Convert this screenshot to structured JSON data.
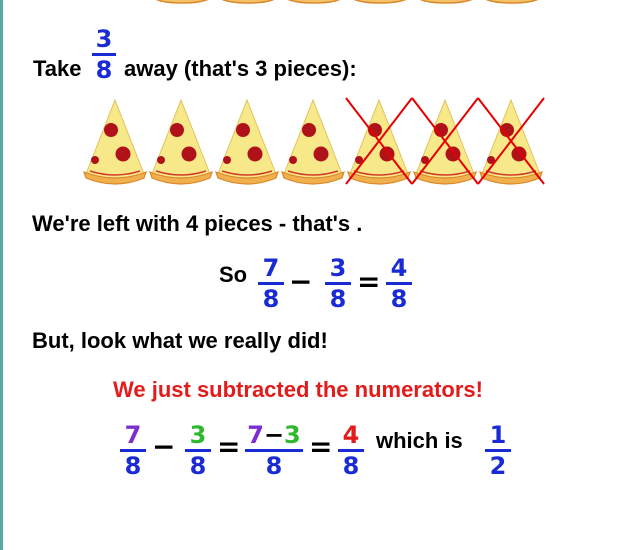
{
  "take_line": {
    "before": "Take",
    "fraction": {
      "num": "3",
      "den": "8"
    },
    "after": "away (that's 3 pieces):"
  },
  "pizza_row": {
    "total": 7,
    "crossed_out": 3
  },
  "left_line": "We're left with 4 pieces - that's .",
  "equation1": {
    "prefix": "So",
    "a": {
      "num": "7",
      "den": "8"
    },
    "op": "−",
    "b": {
      "num": "3",
      "den": "8"
    },
    "eq": "=",
    "c": {
      "num": "4",
      "den": "8"
    }
  },
  "but_line": "But, look what we really did!",
  "highlight": "We just subtracted the numerators!",
  "equation2": {
    "a": {
      "num": "7",
      "den": "8"
    },
    "op": "−",
    "b": {
      "num": "3",
      "den": "8"
    },
    "eq1": "=",
    "mid": {
      "num_left": "7",
      "num_op": "−",
      "num_right": "3",
      "den": "8"
    },
    "eq2": "=",
    "result": {
      "num": "4",
      "den": "8"
    },
    "which": "which is",
    "simplified": {
      "num": "1",
      "den": "2"
    }
  },
  "colors": {
    "blue": "#1a2bd6",
    "red": "#e21b1b",
    "purple": "#7b2fd0",
    "green": "#2fb82f",
    "cross": "#e60000",
    "crust": "#d9882a",
    "cheese": "#f7e98a",
    "pepperoni": "#b0121a",
    "border": "#5aa9a3"
  }
}
